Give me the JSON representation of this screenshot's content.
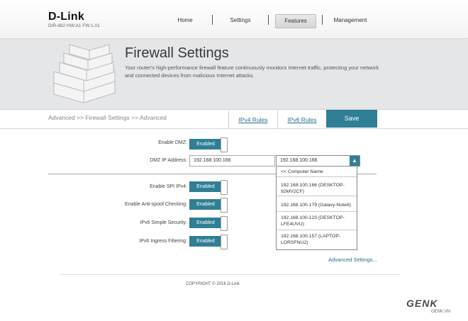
{
  "header": {
    "logo": "D-Link",
    "model": "DIR-882 HW:A1 FW:1.01",
    "nav": [
      "Home",
      "Settings",
      "Features",
      "Management"
    ],
    "active_nav": "Features"
  },
  "hero": {
    "title": "Firewall Settings",
    "description": "Your router's high-performance firewall feature continuously monitors Internet traffic, protecting your network and connected devices from malicious Internet attacks."
  },
  "subnav": {
    "breadcrumb": "Advanced >> Firewall Settings >> Advanced",
    "tab_ipv4": "IPv4 Rules",
    "tab_ipv6": "IPv6 Rules",
    "save_label": "Save"
  },
  "form": {
    "dmz_label": "Enable DMZ:",
    "dmz_state": "Enabled",
    "dmz_ip_label": "DMZ IP Address:",
    "dmz_ip_value": "192.168.100.166",
    "computer_select_value": "192.168.100.166",
    "computer_options": [
      "<< Computer Name",
      "192.168.100.166 (DESKTOP-92MV2CF)",
      "192.168.100.179 (Galaxy-Note8)",
      "192.168.100.123 (DESKTOP-LFE4UVU)",
      "192.168.100.157 (LAPTOP-LORSFNU2)"
    ],
    "spi_label": "Enable SPI IPv4:",
    "spi_state": "Enabled",
    "antispoof_label": "Enable Anti-spoof Checking:",
    "antispoof_state": "Enabled",
    "ipv6_simple_label": "IPv6 Simple Security:",
    "ipv6_simple_state": "Enabled",
    "ipv6_ingress_label": "IPv6 Ingress Filtering:",
    "ipv6_ingress_state": "Enabled",
    "advanced_link": "Advanced Settings..."
  },
  "footer": {
    "copyright": "COPYRIGHT © 2016 D-Link",
    "watermark": "GENK",
    "watermark_sub": "GENK.VN"
  },
  "colors": {
    "accent": "#2f7f96",
    "link": "#2b6d8c"
  }
}
